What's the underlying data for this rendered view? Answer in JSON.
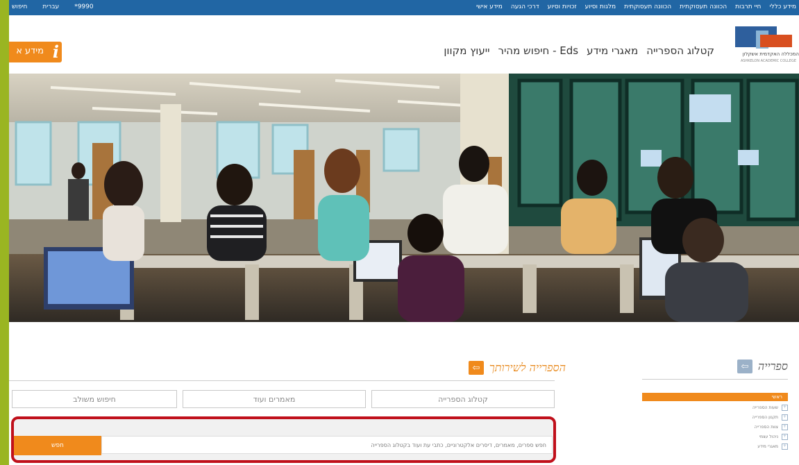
{
  "topbar": {
    "right_links": [
      "מידע כללי",
      "חיי תרבות",
      "הכוונה תעסוקתית",
      "הכוונה תעסוקתית",
      "מלגות וסיוע",
      "זכויות וסיוע",
      "דרכי הגעה",
      "מידע אישי"
    ],
    "left_links": [
      "חיפוש",
      "עברית",
      "*9990"
    ]
  },
  "header": {
    "logo_text": "המכללה האקדמית אשקלון",
    "logo_sub": "ASHKELON ACADEMIC COLLEGE",
    "nav": [
      "קטלוג הספרייה",
      "מאגרי מידע",
      "Eds - חיפוש מהיר",
      "ייעוץ מקוון"
    ],
    "info_label": "מידע א",
    "info_icon": "i"
  },
  "sidebar": {
    "title": "ספרייה",
    "active_item": "ראשי",
    "items": [
      "שעות הספרייה",
      "תקנון הספרייה",
      "צוות הספרייה",
      "ניהול עצמי",
      "מאגרי מידע"
    ]
  },
  "service": {
    "title": "הספרייה לשירותך",
    "tabs": [
      "קטלוג הספרייה",
      "מאמרים ועוד",
      "חיפוש משולב"
    ],
    "search_placeholder": "חפש ספרים, מאמרים, דיסרים אלקטרוניים, כתבי עת ועוד בקטלוג הספרייה",
    "search_button": "חפש"
  },
  "colors": {
    "accent_orange": "#f08a1c",
    "topbar_blue": "#2166a4",
    "highlight_red": "#c0101b",
    "frame_green": "#9ab522"
  }
}
